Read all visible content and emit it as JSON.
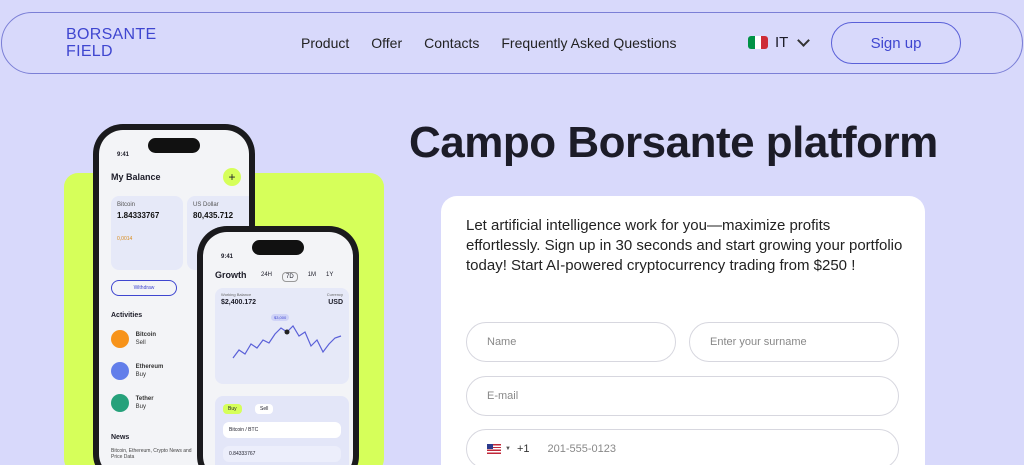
{
  "header": {
    "logo_line1": "BORSANTE",
    "logo_line2": "FIELD",
    "nav": [
      "Product",
      "Offer",
      "Contacts",
      "Frequently Asked Questions"
    ],
    "language": "IT",
    "signup_label": "Sign up"
  },
  "phone1": {
    "time": "9:41",
    "title": "My Balance",
    "bitcoin_label": "Bitcoin",
    "bitcoin_value": "1.84333767",
    "bitcoin_change": "0,0014",
    "usd_label": "US Dollar",
    "usd_value": "80,435.712",
    "withdraw": "Withdraw",
    "activities": "Activities",
    "items": [
      {
        "name": "Bitcoin",
        "action": "Sell",
        "color": "#f7931a"
      },
      {
        "name": "Ethereum",
        "action": "Buy",
        "color": "#627eea"
      },
      {
        "name": "Tether",
        "action": "Buy",
        "color": "#26a17b"
      }
    ],
    "news": "News",
    "news_text": "Bitcoin, Ethereum, Crypto News and Price Data"
  },
  "phone2": {
    "time": "9:41",
    "title": "Growth",
    "tabs": [
      "24H",
      "7D",
      "1M",
      "1Y"
    ],
    "working_balance_label": "Working Balance",
    "working_balance": "$2,400.172",
    "currency_label": "Currency",
    "currency": "USD",
    "peak": "$3,000",
    "buy": "Buy",
    "sell": "Sell",
    "pair": "Bitcoin / BTC",
    "amount": "0.84333767",
    "unit": "BTC"
  },
  "main": {
    "title": "Campo Borsante platform",
    "intro": "Let artificial intelligence work for you—maximize profits effortlessly. Sign up in 30 seconds and start growing your portfolio today! Start AI-powered cryptocurrency trading from $250 !"
  },
  "form": {
    "name_placeholder": "Name",
    "surname_placeholder": "Enter your surname",
    "email_placeholder": "E-mail",
    "dial_code": "+1",
    "phone_placeholder": "201-555-0123"
  },
  "colors": {
    "background": "#d8d9fb",
    "accent": "#3f46d0",
    "lime": "#d6ff5a"
  }
}
